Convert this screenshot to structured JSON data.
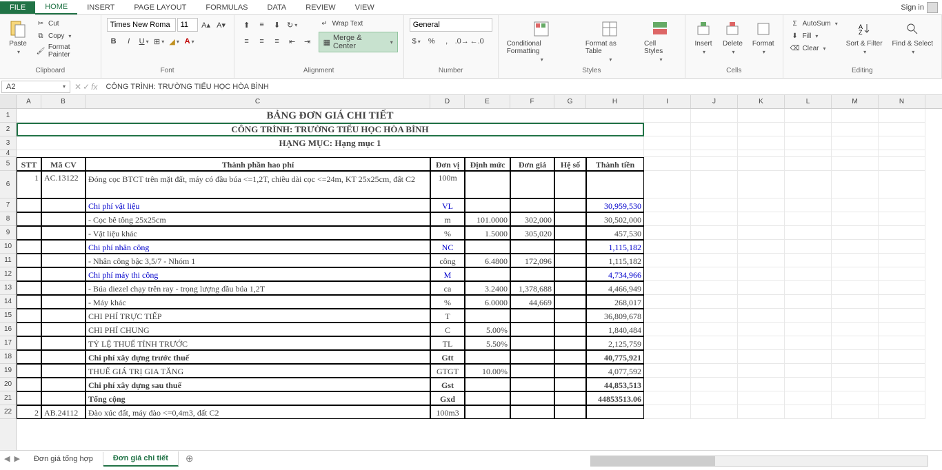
{
  "tabs": {
    "file": "FILE",
    "home": "HOME",
    "insert": "INSERT",
    "pagelayout": "PAGE LAYOUT",
    "formulas": "FORMULAS",
    "data": "DATA",
    "review": "REVIEW",
    "view": "VIEW",
    "signin": "Sign in"
  },
  "ribbon": {
    "clipboard": {
      "paste": "Paste",
      "cut": "Cut",
      "copy": "Copy",
      "fmtpainter": "Format Painter",
      "label": "Clipboard"
    },
    "font": {
      "name": "Times New Roma",
      "size": "11",
      "label": "Font"
    },
    "alignment": {
      "wrap": "Wrap Text",
      "merge": "Merge & Center",
      "label": "Alignment"
    },
    "number": {
      "format": "General",
      "label": "Number"
    },
    "styles": {
      "cond": "Conditional Formatting",
      "fmtas": "Format as Table",
      "cellstyles": "Cell Styles",
      "label": "Styles"
    },
    "cells": {
      "insert": "Insert",
      "delete": "Delete",
      "format": "Format",
      "label": "Cells"
    },
    "editing": {
      "autosum": "AutoSum",
      "fill": "Fill",
      "clear": "Clear",
      "sort": "Sort & Filter",
      "find": "Find & Select",
      "label": "Editing"
    }
  },
  "namebox": "A2",
  "formula": "CÔNG TRÌNH: TRƯỜNG TIỂU HỌC HÒA BÌNH",
  "colLetters": [
    "A",
    "B",
    "C",
    "D",
    "E",
    "F",
    "G",
    "H",
    "I",
    "J",
    "K",
    "L",
    "M",
    "N"
  ],
  "rowNums": [
    1,
    2,
    3,
    4,
    5,
    6,
    7,
    8,
    9,
    10,
    11,
    12,
    13,
    14,
    15,
    16,
    17,
    18,
    19,
    20,
    21,
    22
  ],
  "titles": {
    "r1": "BẢNG ĐƠN GIÁ CHI TIẾT",
    "r2": "CÔNG TRÌNH: TRƯỜNG TIỂU HỌC HÒA BÌNH",
    "r3": "HẠNG MỤC: Hạng mục 1"
  },
  "headers": {
    "stt": "STT",
    "macv": "Mã CV",
    "thanhphan": "Thành phần hao phí",
    "donvi": "Đơn vị",
    "dinhmuc": "Định mức",
    "dongia": "Đơn giá",
    "heso": "Hệ số",
    "thanhtien": "Thành tiền"
  },
  "rows": {
    "r6": {
      "stt": "1",
      "macv": "AC.13122",
      "c": "Đóng cọc BTCT trên mặt đất, máy có đầu búa <=1,2T, chiều dài cọc <=24m, KT 25x25cm, đất C2",
      "d": "100m"
    },
    "r7": {
      "c": "Chi phí vật liệu",
      "d": "VL",
      "h": "30,959,530"
    },
    "r8": {
      "c": " - Cọc bê tông 25x25cm",
      "d": "m",
      "e": "101.0000",
      "f": "302,000",
      "h": "30,502,000"
    },
    "r9": {
      "c": " - Vật liệu khác",
      "d": "%",
      "e": "1.5000",
      "f": "305,020",
      "h": "457,530"
    },
    "r10": {
      "c": "Chi phí nhân công",
      "d": "NC",
      "h": "1,115,182"
    },
    "r11": {
      "c": " - Nhân công bậc 3,5/7 - Nhóm 1",
      "d": "công",
      "e": "6.4800",
      "f": "172,096",
      "h": "1,115,182"
    },
    "r12": {
      "c": "Chi phí máy thi công",
      "d": "M",
      "h": "4,734,966"
    },
    "r13": {
      "c": " - Búa diezel chạy trên ray - trọng lượng đầu búa 1,2T",
      "d": "ca",
      "e": "3.2400",
      "f": "1,378,688",
      "h": "4,466,949"
    },
    "r14": {
      "c": " - Máy khác",
      "d": "%",
      "e": "6.0000",
      "f": "44,669",
      "h": "268,017"
    },
    "r15": {
      "c": "CHI PHÍ TRỰC TIẾP",
      "d": "T",
      "h": "36,809,678"
    },
    "r16": {
      "c": "CHI PHÍ CHUNG",
      "d": "C",
      "e": "5.00%",
      "h": "1,840,484"
    },
    "r17": {
      "c": "TỶ LỆ THUẾ TÍNH TRƯỚC",
      "d": "TL",
      "e": "5.50%",
      "h": "2,125,759"
    },
    "r18": {
      "c": "Chi phí xây dựng trước thuế",
      "d": "Gtt",
      "h": "40,775,921"
    },
    "r19": {
      "c": "THUẾ GIÁ TRỊ GIA TĂNG",
      "d": "GTGT",
      "e": "10.00%",
      "h": "4,077,592"
    },
    "r20": {
      "c": "Chi phí xây dựng sau thuế",
      "d": "Gst",
      "h": "44,853,513"
    },
    "r21": {
      "c": "Tổng cộng",
      "d": "Gxd",
      "h": "44853513.06"
    },
    "r22": {
      "stt": "2",
      "macv": "AB.24112",
      "c": "Đào xúc đất, máy đào <=0,4m3, đất C2",
      "d": "100m3"
    }
  },
  "sheets": {
    "s1": "Đơn giá tổng hợp",
    "s2": "Đơn giá chi tiết"
  }
}
